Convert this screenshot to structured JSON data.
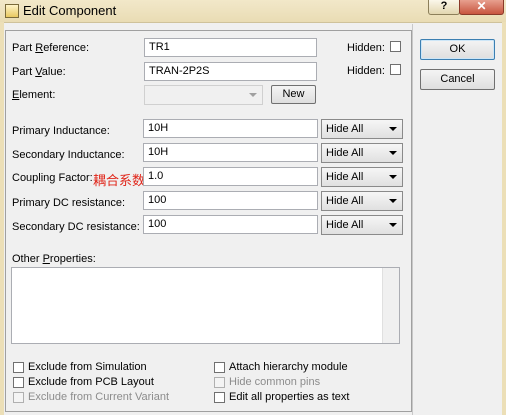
{
  "window": {
    "title": "Edit Component",
    "help_label": "?",
    "close_label": "✕"
  },
  "fields": {
    "part_reference": {
      "label_pre": "Part ",
      "label_u": "R",
      "label_post": "eference:",
      "value": "TR1"
    },
    "part_value": {
      "label_pre": "Part ",
      "label_u": "V",
      "label_post": "alue:",
      "value": "TRAN-2P2S"
    },
    "element": {
      "label_pre": "",
      "label_u": "E",
      "label_post": "lement:",
      "value": ""
    },
    "hidden_label": "Hidden:",
    "new_button": "New"
  },
  "properties": [
    {
      "label": "Primary Inductance:",
      "value": "10H",
      "visibility": "Hide All"
    },
    {
      "label": "Secondary Inductance:",
      "value": "10H",
      "visibility": "Hide All"
    },
    {
      "label": "Coupling Factor:",
      "annotation": "耦合系数",
      "value": "1.0",
      "visibility": "Hide All"
    },
    {
      "label": "Primary DC resistance:",
      "value": "100",
      "visibility": "Hide All"
    },
    {
      "label": "Secondary DC resistance:",
      "value": "100",
      "visibility": "Hide All"
    }
  ],
  "other_properties": {
    "label_pre": "Other ",
    "label_u": "P",
    "label_post": "roperties:",
    "value": ""
  },
  "checkboxes_left": [
    {
      "label": "Exclude from Simulation",
      "checked": false,
      "enabled": true
    },
    {
      "label": "Exclude from PCB Layout",
      "checked": false,
      "enabled": true
    },
    {
      "label": "Exclude from Current Variant",
      "checked": false,
      "enabled": false
    }
  ],
  "checkboxes_right": [
    {
      "label": "Attach hierarchy module",
      "checked": false,
      "enabled": true
    },
    {
      "label": "Hide common pins",
      "checked": false,
      "enabled": false
    },
    {
      "label": "Edit all properties as text",
      "checked": false,
      "enabled": true
    }
  ],
  "buttons": {
    "ok": "OK",
    "cancel": "Cancel"
  },
  "colors": {
    "annotation": "#e0261a",
    "titlebar": "#f2e8c9"
  }
}
